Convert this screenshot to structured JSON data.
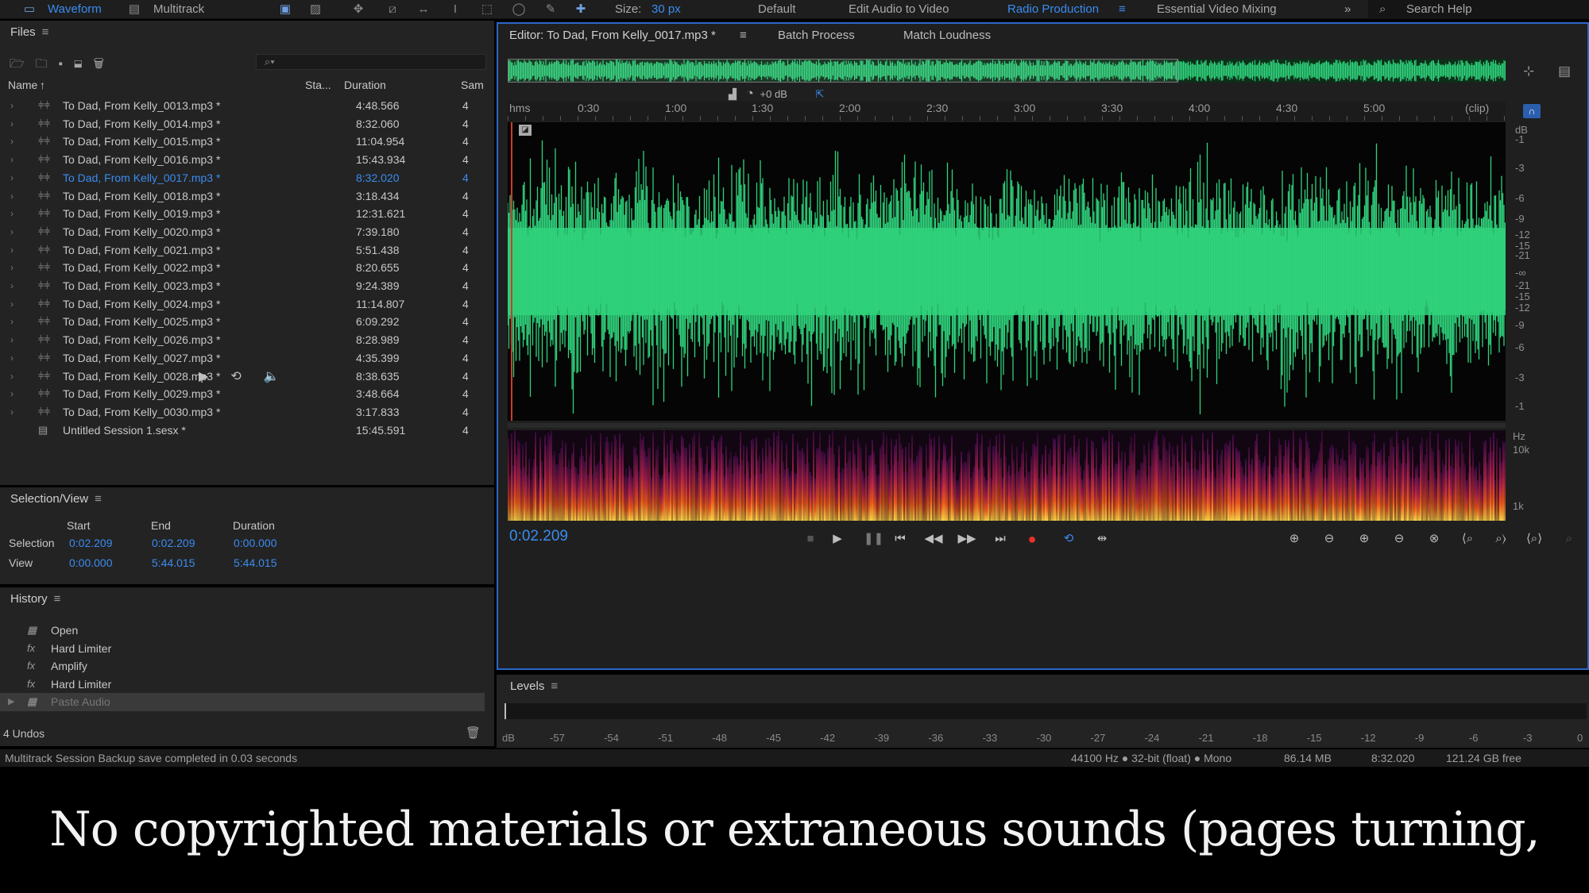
{
  "topbar": {
    "waveform": "Waveform",
    "multitrack": "Multitrack",
    "size_label": "Size:",
    "size_value": "30 px",
    "workspaces": [
      "Default",
      "Edit Audio to Video",
      "Radio Production",
      "Essential Video Mixing"
    ],
    "search": "Search Help"
  },
  "files": {
    "title": "Files",
    "col_name": "Name",
    "col_status": "Sta...",
    "col_duration": "Duration",
    "col_sample": "Sam",
    "rows": [
      {
        "name": "To Dad, From Kelly_0013.mp3 *",
        "duration": "4:48.566",
        "sample": "4"
      },
      {
        "name": "To Dad, From Kelly_0014.mp3 *",
        "duration": "8:32.060",
        "sample": "4"
      },
      {
        "name": "To Dad, From Kelly_0015.mp3 *",
        "duration": "11:04.954",
        "sample": "4"
      },
      {
        "name": "To Dad, From Kelly_0016.mp3 *",
        "duration": "15:43.934",
        "sample": "4"
      },
      {
        "name": "To Dad, From Kelly_0017.mp3 *",
        "duration": "8:32.020",
        "sample": "4"
      },
      {
        "name": "To Dad, From Kelly_0018.mp3 *",
        "duration": "3:18.434",
        "sample": "4"
      },
      {
        "name": "To Dad, From Kelly_0019.mp3 *",
        "duration": "12:31.621",
        "sample": "4"
      },
      {
        "name": "To Dad, From Kelly_0020.mp3 *",
        "duration": "7:39.180",
        "sample": "4"
      },
      {
        "name": "To Dad, From Kelly_0021.mp3 *",
        "duration": "5:51.438",
        "sample": "4"
      },
      {
        "name": "To Dad, From Kelly_0022.mp3 *",
        "duration": "8:20.655",
        "sample": "4"
      },
      {
        "name": "To Dad, From Kelly_0023.mp3 *",
        "duration": "9:24.389",
        "sample": "4"
      },
      {
        "name": "To Dad, From Kelly_0024.mp3 *",
        "duration": "11:14.807",
        "sample": "4"
      },
      {
        "name": "To Dad, From Kelly_0025.mp3 *",
        "duration": "6:09.292",
        "sample": "4"
      },
      {
        "name": "To Dad, From Kelly_0026.mp3 *",
        "duration": "8:28.989",
        "sample": "4"
      },
      {
        "name": "To Dad, From Kelly_0027.mp3 *",
        "duration": "4:35.399",
        "sample": "4"
      },
      {
        "name": "To Dad, From Kelly_0028.mp3 *",
        "duration": "8:38.635",
        "sample": "4"
      },
      {
        "name": "To Dad, From Kelly_0029.mp3 *",
        "duration": "3:48.664",
        "sample": "4"
      },
      {
        "name": "To Dad, From Kelly_0030.mp3 *",
        "duration": "3:17.833",
        "sample": "4"
      },
      {
        "name": "Untitled Session 1.sesx *",
        "duration": "15:45.591",
        "sample": "4"
      }
    ]
  },
  "selection_view": {
    "title": "Selection/View",
    "col_start": "Start",
    "col_end": "End",
    "col_duration": "Duration",
    "selection_label": "Selection",
    "selection": {
      "start": "0:02.209",
      "end": "0:02.209",
      "duration": "0:00.000"
    },
    "view_label": "View",
    "view": {
      "start": "0:00.000",
      "end": "5:44.015",
      "duration": "5:44.015"
    }
  },
  "history": {
    "title": "History",
    "items": [
      "Open",
      "Hard Limiter",
      "Amplify",
      "Hard Limiter",
      "Paste Audio"
    ],
    "undos": "4 Undos"
  },
  "editor": {
    "tab_title": "Editor: To Dad, From Kelly_0017.mp3 *",
    "tab_batch": "Batch Process",
    "tab_loudness": "Match Loudness",
    "gain": "+0 dB",
    "ruler_ticks": [
      "hms",
      "0:30",
      "1:00",
      "1:30",
      "2:00",
      "2:30",
      "3:00",
      "3:30",
      "4:00",
      "4:30",
      "5:00",
      "(clip)"
    ],
    "db_scale": [
      "dB",
      "-1",
      "-3",
      "-6",
      "-9",
      "-12",
      "-15",
      "-21",
      "-∞",
      "-21",
      "-15",
      "-12",
      "-9",
      "-6",
      "-3",
      "-1"
    ],
    "hz_scale": [
      "Hz",
      "10k",
      "1k"
    ],
    "time": "0:02.209",
    "colors": {
      "wave": "#2fd37c",
      "accent": "#3a8cf0",
      "record": "#e5322d"
    }
  },
  "levels": {
    "title": "Levels",
    "scale": [
      "dB",
      "-57",
      "-54",
      "-51",
      "-48",
      "-45",
      "-42",
      "-39",
      "-36",
      "-33",
      "-30",
      "-27",
      "-24",
      "-21",
      "-18",
      "-15",
      "-12",
      "-9",
      "-6",
      "-3",
      "0"
    ]
  },
  "status": {
    "message": "Multitrack Session Backup save completed in 0.03 seconds",
    "format": "44100 Hz ● 32-bit (float) ● Mono",
    "size": "86.14 MB",
    "duration": "8:32.020",
    "free": "121.24 GB free"
  },
  "caption": "No copyrighted materials or extraneous sounds (pages turning, etc.)"
}
